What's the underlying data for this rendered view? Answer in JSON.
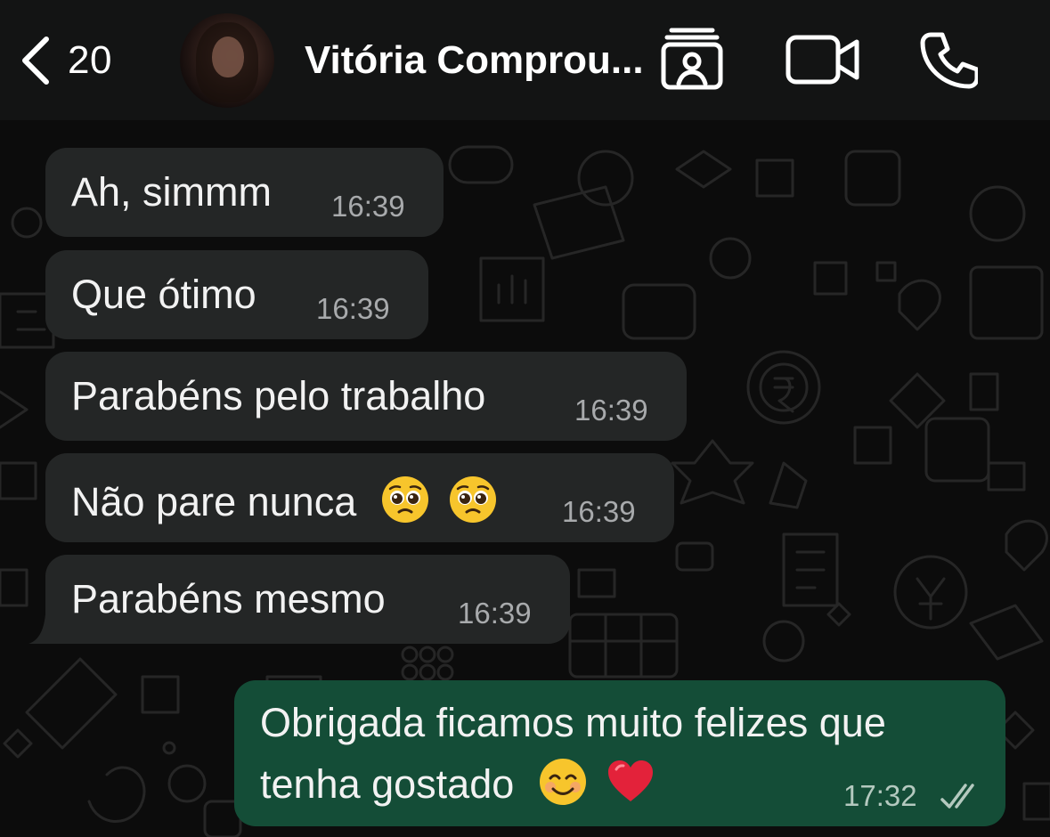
{
  "header": {
    "back_count": "20",
    "contact_name": "Vitória Comprou...",
    "icons": [
      "back-chevron-icon",
      "contact-card-icon",
      "video-call-icon",
      "voice-call-icon"
    ]
  },
  "messages": [
    {
      "direction": "in",
      "text": "Ah, simmm",
      "time": "16:39"
    },
    {
      "direction": "in",
      "text": "Que ótimo",
      "time": "16:39"
    },
    {
      "direction": "in",
      "text": "Parabéns pelo trabalho",
      "time": "16:39"
    },
    {
      "direction": "in",
      "text": "Não pare nunca",
      "emojis": [
        "pleading-face",
        "pleading-face"
      ],
      "time": "16:39"
    },
    {
      "direction": "in",
      "text": "Parabéns mesmo",
      "time": "16:39"
    },
    {
      "direction": "out",
      "text_line1": "Obrigada ficamos muito felizes que",
      "text_line2": "tenha gostado",
      "emojis": [
        "smiling-face",
        "red-heart"
      ],
      "time": "17:32",
      "status": "read-double-check"
    }
  ],
  "colors": {
    "header_bg": "#131414",
    "incoming_bubble": "#242626",
    "outgoing_bubble": "#144d37",
    "timestamp": "#a8aaac"
  }
}
